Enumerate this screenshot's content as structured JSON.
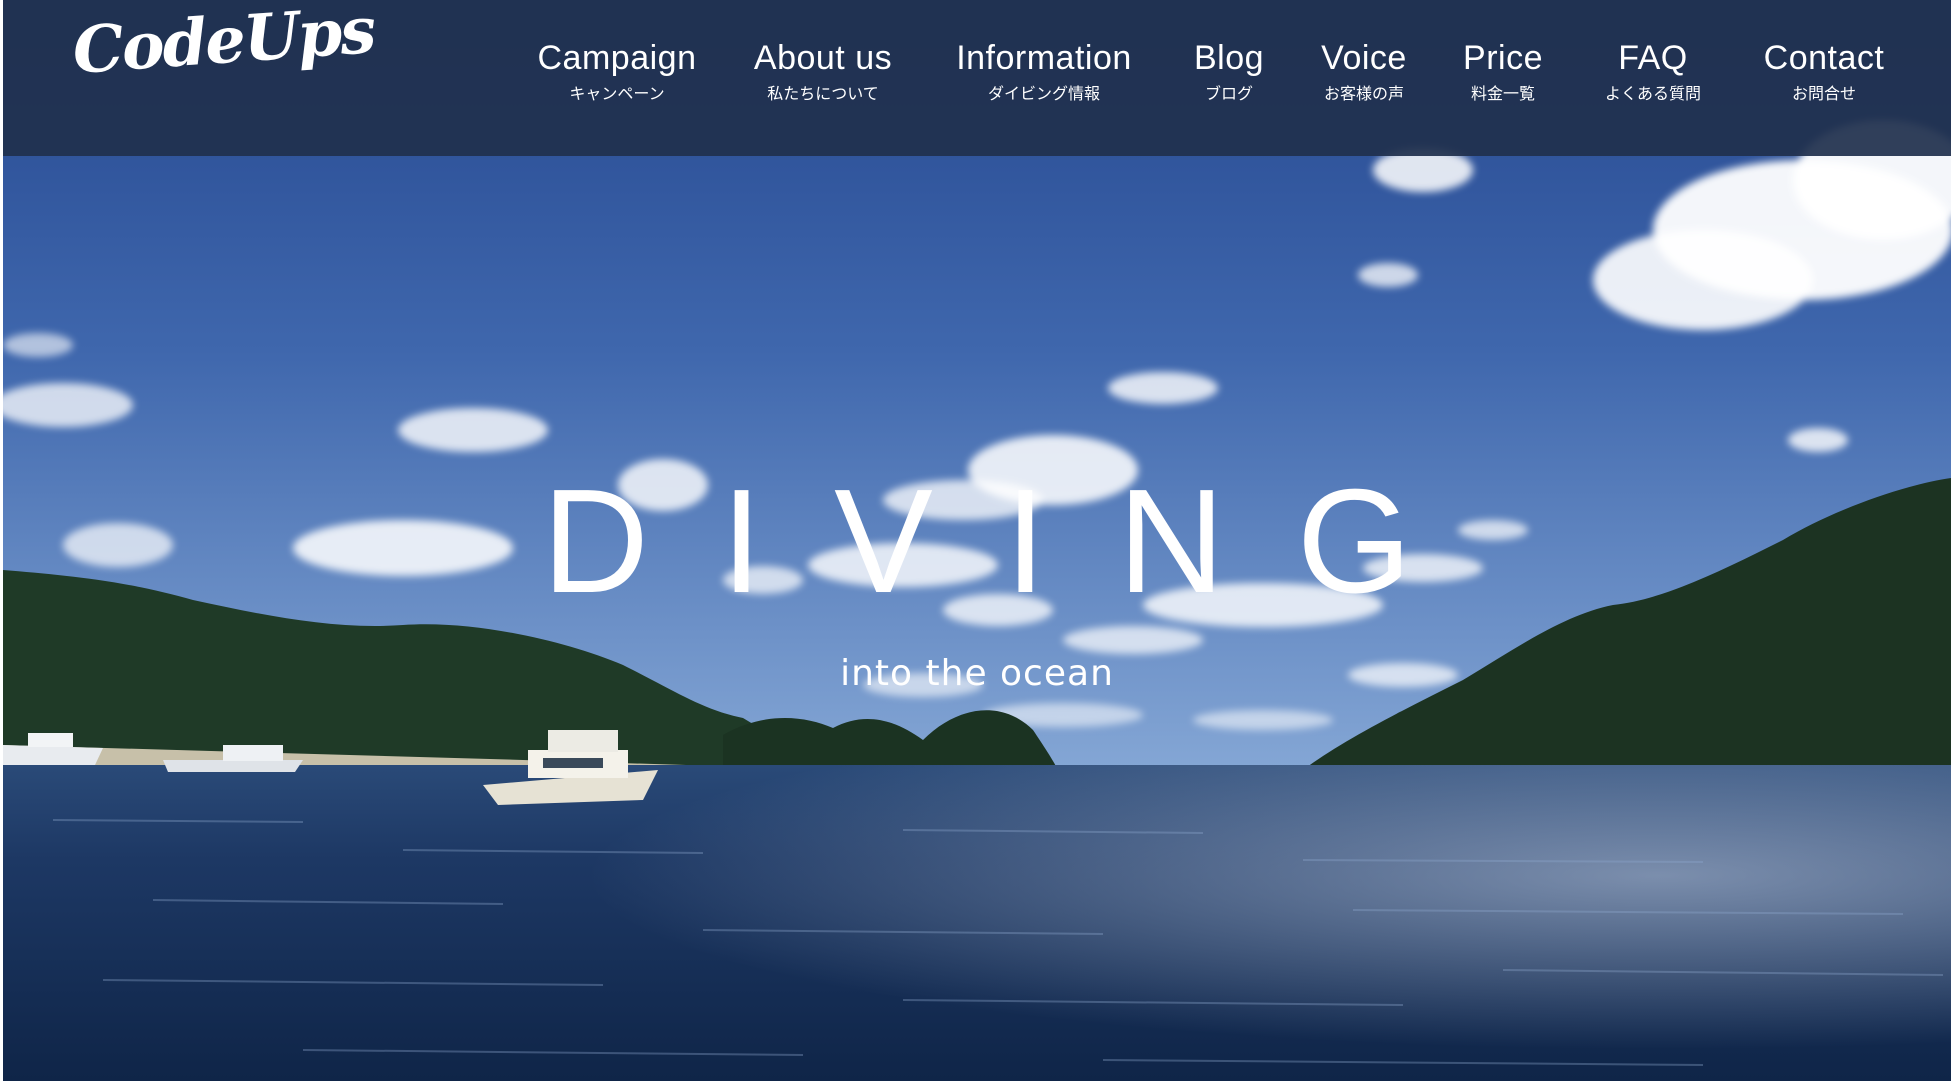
{
  "brand": {
    "logo_text": "CodeUps"
  },
  "nav": {
    "items": [
      {
        "en": "Campaign",
        "ja": "キャンペーン"
      },
      {
        "en": "About us",
        "ja": "私たちについて"
      },
      {
        "en": "Information",
        "ja": "ダイビング情報"
      },
      {
        "en": "Blog",
        "ja": "ブログ"
      },
      {
        "en": "Voice",
        "ja": "お客様の声"
      },
      {
        "en": "Price",
        "ja": "料金一覧"
      },
      {
        "en": "FAQ",
        "ja": "よくある質問"
      },
      {
        "en": "Contact",
        "ja": "お問合せ"
      }
    ]
  },
  "hero": {
    "title": "DIVING",
    "subtitle": "into the ocean"
  },
  "colors": {
    "header_bg": "#20304e",
    "sky_top": "#25478f",
    "sky_bottom": "#7ea2d2",
    "sea": "#17305a",
    "text": "#ffffff"
  }
}
